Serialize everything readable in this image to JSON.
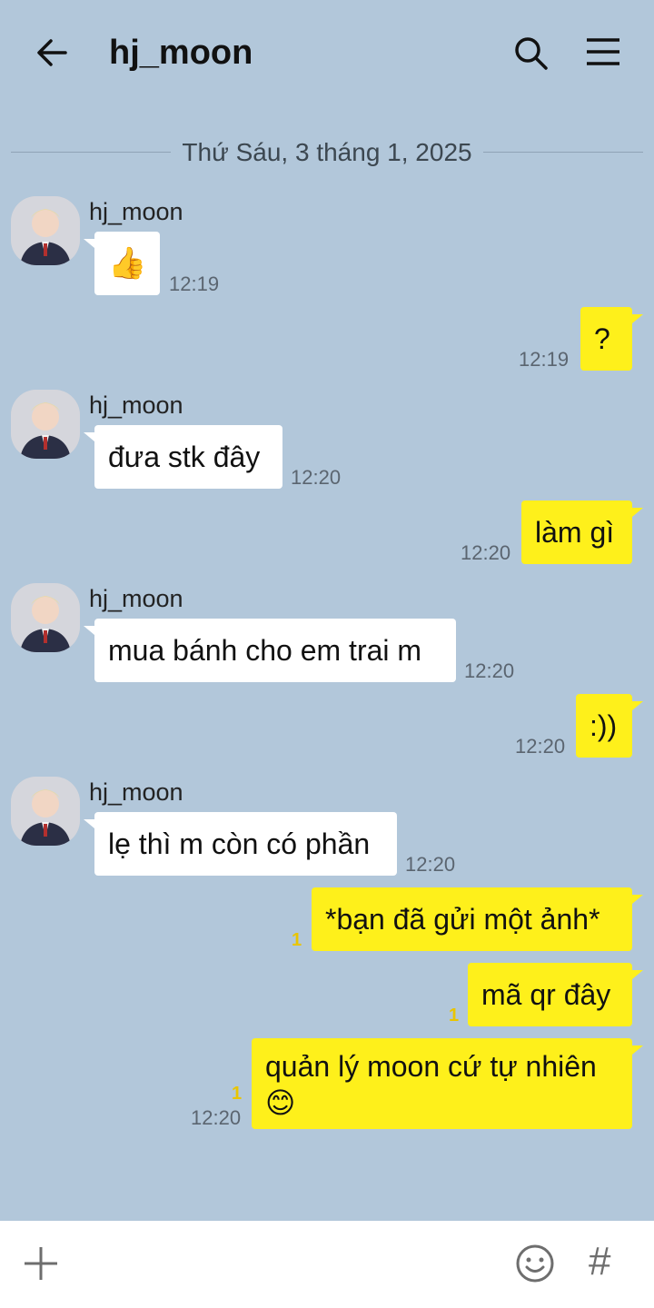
{
  "header": {
    "title": "hj_moon"
  },
  "date_separator": "Thứ Sáu, 3 tháng 1, 2025",
  "messages": [
    {
      "sender": "hj_moon",
      "text": "👍",
      "time": "12:19"
    },
    {
      "text": "?",
      "time": "12:19"
    },
    {
      "sender": "hj_moon",
      "text": "đưa stk đây",
      "time": "12:20"
    },
    {
      "text": "làm gì",
      "time": "12:20"
    },
    {
      "sender": "hj_moon",
      "text": "mua bánh cho em trai m",
      "time": "12:20"
    },
    {
      "text": ":))",
      "time": "12:20"
    },
    {
      "sender": "hj_moon",
      "text": "lẹ thì m còn có phần",
      "time": "12:20"
    },
    {
      "text": "*bạn đã gửi một ảnh*",
      "unread": "1"
    },
    {
      "text": "mã qr đây",
      "unread": "1"
    },
    {
      "text_line1": "quản lý moon cứ tự nhiên",
      "text_line2": "😊",
      "unread": "1",
      "time": "12:20"
    }
  ],
  "icons": {
    "back": "arrow-left-icon",
    "search": "search-icon",
    "menu": "hamburger-menu-icon",
    "attach": "plus-icon",
    "emoji": "smiley-icon",
    "hashtag": "hash-icon"
  },
  "input": {
    "hash_glyph": "#"
  },
  "colors": {
    "background": "#b2c7da",
    "outgoing_bubble": "#fef01b",
    "incoming_bubble": "#ffffff",
    "unread": "#e9c500"
  }
}
